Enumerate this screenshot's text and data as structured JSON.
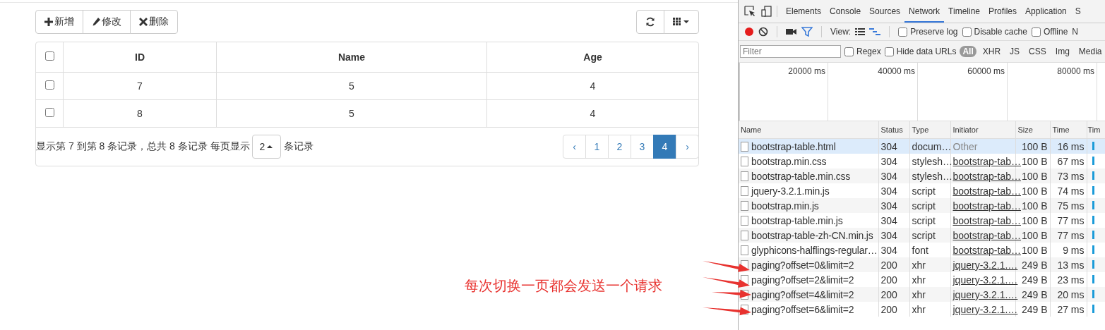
{
  "toolbar": {
    "buttons": [
      {
        "kind": "add",
        "label": "新增"
      },
      {
        "kind": "edit",
        "label": "修改"
      },
      {
        "kind": "delete",
        "label": "删除"
      }
    ]
  },
  "table": {
    "select_all_checked": false,
    "columns": [
      "ID",
      "Name",
      "Age"
    ],
    "rows": [
      {
        "checked": false,
        "cells": [
          "7",
          "5",
          "4"
        ]
      },
      {
        "checked": false,
        "cells": [
          "8",
          "5",
          "4"
        ]
      }
    ]
  },
  "pagination": {
    "summary": "显示第 7 到第 8 条记录，总共 8 条记录 每页显示",
    "page_size": "2",
    "page_size_suffix": "条记录",
    "prev": "‹",
    "next": "›",
    "pages": [
      {
        "label": "1",
        "selected": false
      },
      {
        "label": "2",
        "selected": false
      },
      {
        "label": "3",
        "selected": false
      },
      {
        "label": "4",
        "selected": true
      }
    ]
  },
  "annotation": "每次切换一页都会发送一个请求",
  "devtools": {
    "tabs": [
      {
        "label": "Elements",
        "selected": false
      },
      {
        "label": "Console",
        "selected": false
      },
      {
        "label": "Sources",
        "selected": false
      },
      {
        "label": "Network",
        "selected": true
      },
      {
        "label": "Timeline",
        "selected": false
      },
      {
        "label": "Profiles",
        "selected": false
      },
      {
        "label": "Application",
        "selected": false
      },
      {
        "label": "S",
        "selected": false
      }
    ],
    "recording": true,
    "view_label": "View:",
    "options": [
      {
        "label": "Preserve log",
        "checked": false
      },
      {
        "label": "Disable cache",
        "checked": false
      },
      {
        "label": "Offline",
        "checked": false
      },
      {
        "label": "N"
      }
    ],
    "filter_placeholder": "Filter",
    "filter_options": [
      {
        "label": "Regex",
        "checked": false
      },
      {
        "label": "Hide data URLs",
        "checked": false
      }
    ],
    "type_filters": [
      {
        "label": "All",
        "selected": true
      },
      {
        "label": "XHR",
        "selected": false
      },
      {
        "label": "JS",
        "selected": false
      },
      {
        "label": "CSS",
        "selected": false
      },
      {
        "label": "Img",
        "selected": false
      },
      {
        "label": "Media",
        "selected": false
      }
    ],
    "timeline_ticks": [
      "20000 ms",
      "40000 ms",
      "60000 ms",
      "80000 ms"
    ],
    "columns": [
      "Name",
      "Status",
      "Type",
      "Initiator",
      "Size",
      "Time",
      "Tim"
    ],
    "requests": [
      {
        "name": "bootstrap-table.html",
        "status": "304",
        "type": "docum…",
        "initiator": "Other",
        "initiator_link": false,
        "size": "100 B",
        "time": "16 ms",
        "selected": true
      },
      {
        "name": "bootstrap.min.css",
        "status": "304",
        "type": "stylesh…",
        "initiator": "bootstrap-tab…",
        "initiator_link": true,
        "size": "100 B",
        "time": "67 ms",
        "selected": false
      },
      {
        "name": "bootstrap-table.min.css",
        "status": "304",
        "type": "stylesh…",
        "initiator": "bootstrap-tab…",
        "initiator_link": true,
        "size": "100 B",
        "time": "73 ms",
        "selected": false
      },
      {
        "name": "jquery-3.2.1.min.js",
        "status": "304",
        "type": "script",
        "initiator": "bootstrap-tab…",
        "initiator_link": true,
        "size": "100 B",
        "time": "74 ms",
        "selected": false
      },
      {
        "name": "bootstrap.min.js",
        "status": "304",
        "type": "script",
        "initiator": "bootstrap-tab…",
        "initiator_link": true,
        "size": "100 B",
        "time": "75 ms",
        "selected": false
      },
      {
        "name": "bootstrap-table.min.js",
        "status": "304",
        "type": "script",
        "initiator": "bootstrap-tab…",
        "initiator_link": true,
        "size": "100 B",
        "time": "77 ms",
        "selected": false
      },
      {
        "name": "bootstrap-table-zh-CN.min.js",
        "status": "304",
        "type": "script",
        "initiator": "bootstrap-tab…",
        "initiator_link": true,
        "size": "100 B",
        "time": "77 ms",
        "selected": false
      },
      {
        "name": "glyphicons-halflings-regular…",
        "status": "304",
        "type": "font",
        "initiator": "bootstrap-tab…",
        "initiator_link": true,
        "size": "100 B",
        "time": "9 ms",
        "selected": false
      },
      {
        "name": "paging?offset=0&limit=2",
        "status": "200",
        "type": "xhr",
        "initiator": "jquery-3.2.1.…",
        "initiator_link": true,
        "size": "249 B",
        "time": "13 ms",
        "selected": false
      },
      {
        "name": "paging?offset=2&limit=2",
        "status": "200",
        "type": "xhr",
        "initiator": "jquery-3.2.1.…",
        "initiator_link": true,
        "size": "249 B",
        "time": "23 ms",
        "selected": false
      },
      {
        "name": "paging?offset=4&limit=2",
        "status": "200",
        "type": "xhr",
        "initiator": "jquery-3.2.1.…",
        "initiator_link": true,
        "size": "249 B",
        "time": "20 ms",
        "selected": false
      },
      {
        "name": "paging?offset=6&limit=2",
        "status": "200",
        "type": "xhr",
        "initiator": "jquery-3.2.1.…",
        "initiator_link": true,
        "size": "249 B",
        "time": "27 ms",
        "selected": false
      }
    ]
  }
}
